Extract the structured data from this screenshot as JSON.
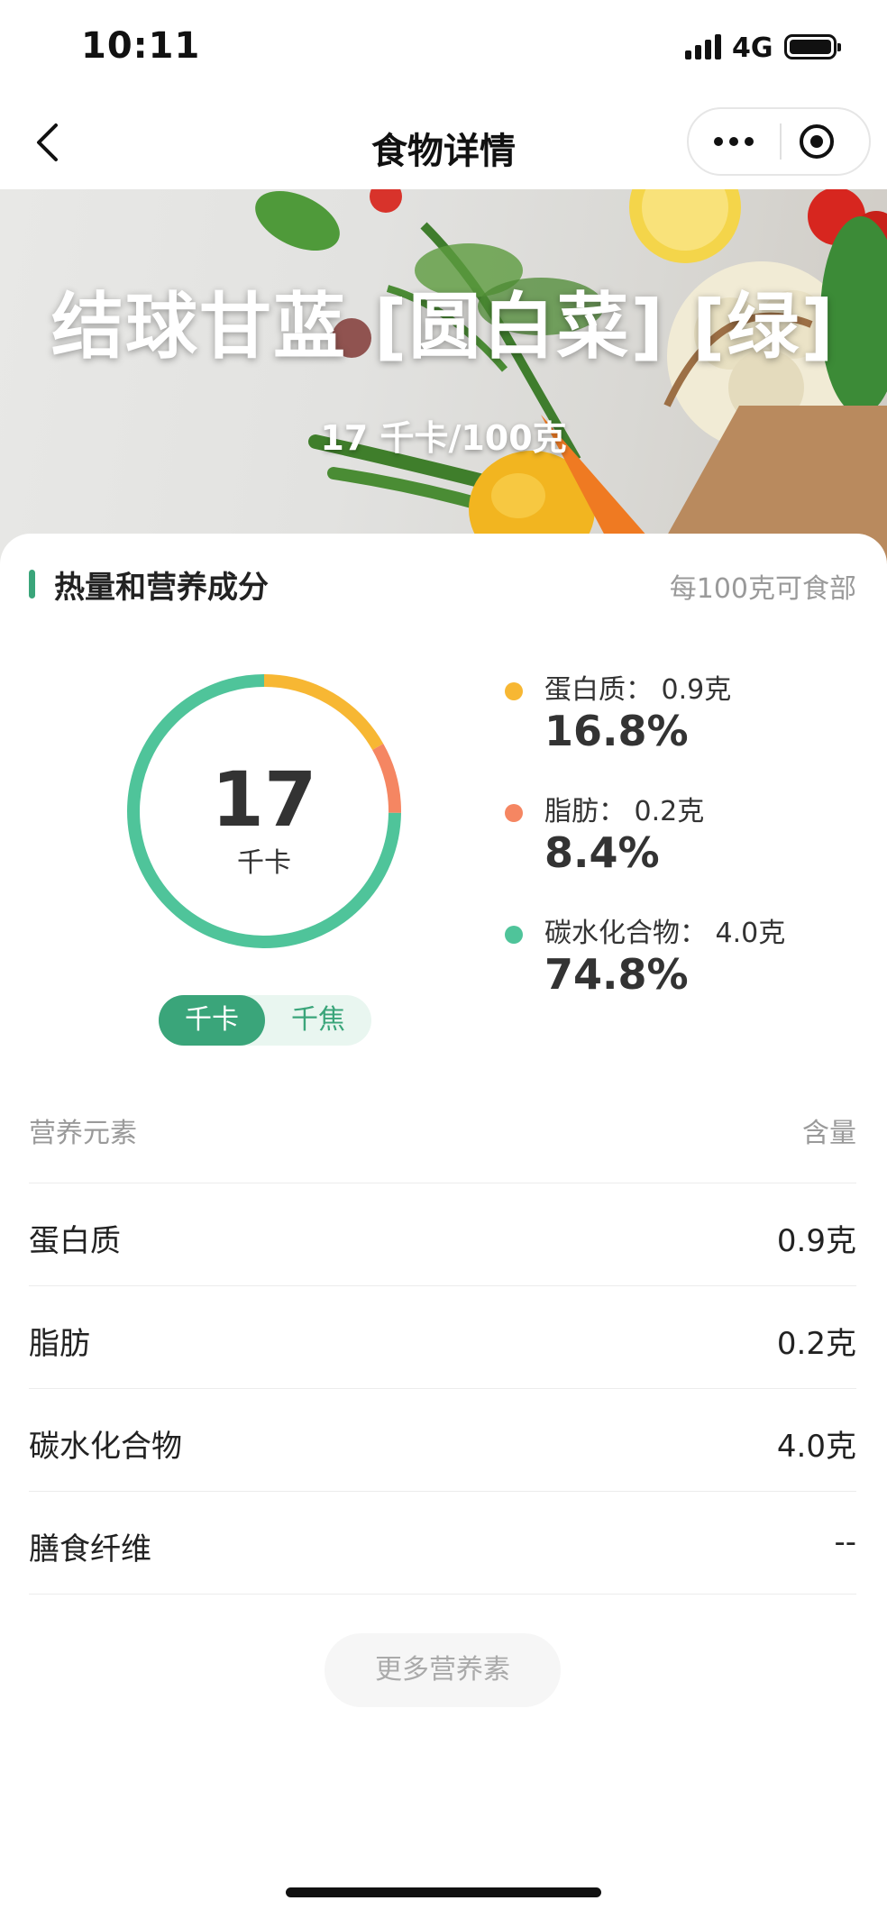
{
  "status_bar": {
    "time": "10:11",
    "network": "4G"
  },
  "nav": {
    "title": "食物详情"
  },
  "hero": {
    "title": "结球甘蓝 [圆白菜] [绿]",
    "subtitle": "17 千卡/100克"
  },
  "section": {
    "title": "热量和营养成分",
    "note": "每100克可食部"
  },
  "energy": {
    "value": "17",
    "unit": "千卡",
    "toggle": {
      "active": "千卡",
      "inactive": "千焦"
    }
  },
  "chart_data": {
    "type": "pie",
    "categories": [
      "蛋白质",
      "脂肪",
      "碳水化合物"
    ],
    "values": [
      16.8,
      8.4,
      74.8
    ],
    "colors": [
      "#f7b733",
      "#f58662",
      "#4fc49a"
    ]
  },
  "macros": [
    {
      "label": "蛋白质： 0.9克",
      "percent": "16.8%",
      "color": "#f7b733"
    },
    {
      "label": "脂肪： 0.2克",
      "percent": "8.4%",
      "color": "#f58662"
    },
    {
      "label": "碳水化合物： 4.0克",
      "percent": "74.8%",
      "color": "#4fc49a"
    }
  ],
  "table": {
    "header_name": "营养元素",
    "header_value": "含量",
    "rows": [
      {
        "name": "蛋白质",
        "value": "0.9克"
      },
      {
        "name": "脂肪",
        "value": "0.2克"
      },
      {
        "name": "碳水化合物",
        "value": "4.0克"
      },
      {
        "name": "膳食纤维",
        "value": "--"
      }
    ]
  },
  "more_button": "更多营养素",
  "colors": {
    "accent": "#3aa57a"
  }
}
